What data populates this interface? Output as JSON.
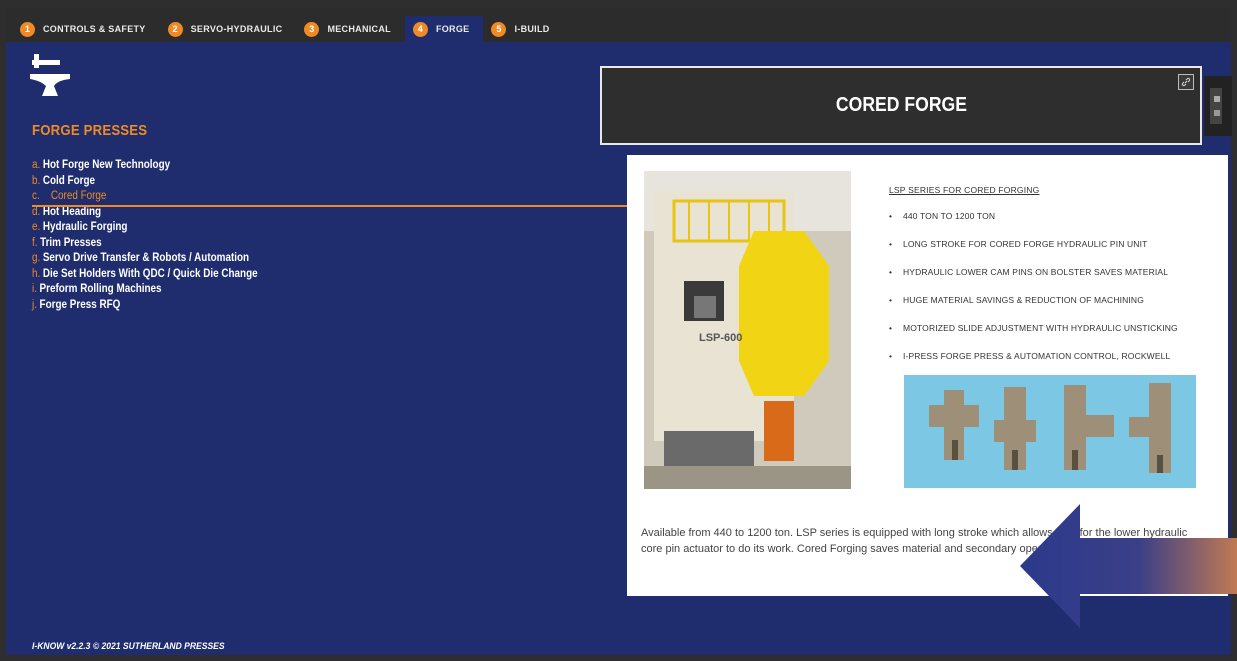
{
  "tabs": [
    {
      "num": "1",
      "label": "CONTROLS & SAFETY"
    },
    {
      "num": "2",
      "label": "SERVO-HYDRAULIC"
    },
    {
      "num": "3",
      "label": "MECHANICAL"
    },
    {
      "num": "4",
      "label": "FORGE",
      "active": true
    },
    {
      "num": "5",
      "label": "I-BUILD"
    }
  ],
  "sidebar": {
    "icon": "anvil-icon",
    "title": "FORGE PRESSES",
    "items": [
      {
        "letter": "a.",
        "label": "Hot Forge New Technology"
      },
      {
        "letter": "b.",
        "label": "Cold Forge"
      },
      {
        "letter": "c.",
        "label": "Cored Forge",
        "active": true
      },
      {
        "letter": "d.",
        "label": "Hot Heading"
      },
      {
        "letter": "e.",
        "label": "Hydraulic Forging"
      },
      {
        "letter": "f.",
        "label": "Trim Presses"
      },
      {
        "letter": "g.",
        "label": "Servo Drive Transfer & Robots / Automation"
      },
      {
        "letter": "h.",
        "label": "Die Set Holders With QDC / Quick Die Change"
      },
      {
        "letter": "i.",
        "label": "Preform Rolling Machines"
      },
      {
        "letter": "j.",
        "label": "Forge Press RFQ"
      }
    ]
  },
  "panel": {
    "title": "CORED FORGE",
    "link_icon": "link-icon",
    "photo_label": "LSP-600",
    "spec_heading": "LSP SERIES FOR CORED FORGING",
    "bullets": [
      "440 TON TO 1200 TON",
      "LONG STROKE FOR CORED FORGE HYDRAULIC PIN UNIT",
      "HYDRAULIC LOWER CAM PINS ON BOLSTER SAVES MATERIAL",
      "HUGE MATERIAL SAVINGS & REDUCTION OF MACHINING",
      "MOTORIZED SLIDE ADJUSTMENT WITH HYDRAULIC UNSTICKING",
      "I-PRESS FORGE PRESS & AUTOMATION CONTROL, ROCKWELL"
    ],
    "description": "Available from 440 to 1200 ton. LSP series is equipped with long stroke which allows time for the lower hydraulic core pin actuator to do its work. Cored Forging saves material and secondary operations."
  },
  "footer": "I-KNOW v2.2.3  © 2021 SUTHERLAND PRESSES",
  "colors": {
    "accent": "#f08a24",
    "background": "#1f2d6e",
    "arrow": "#2b3a8c"
  }
}
